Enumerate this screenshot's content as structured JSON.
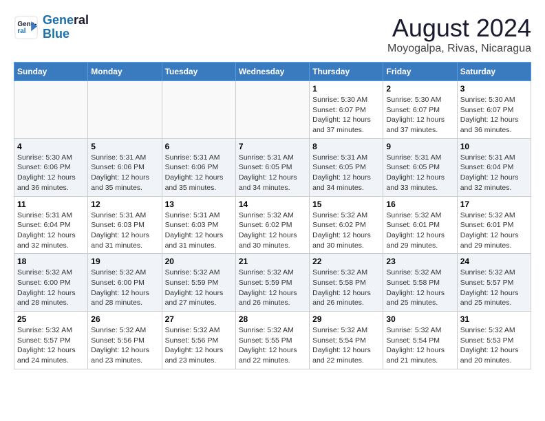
{
  "logo": {
    "line1": "General",
    "line2": "Blue"
  },
  "title": "August 2024",
  "subtitle": "Moyogalpa, Rivas, Nicaragua",
  "days_of_week": [
    "Sunday",
    "Monday",
    "Tuesday",
    "Wednesday",
    "Thursday",
    "Friday",
    "Saturday"
  ],
  "weeks": [
    [
      {
        "num": "",
        "info": ""
      },
      {
        "num": "",
        "info": ""
      },
      {
        "num": "",
        "info": ""
      },
      {
        "num": "",
        "info": ""
      },
      {
        "num": "1",
        "info": "Sunrise: 5:30 AM\nSunset: 6:07 PM\nDaylight: 12 hours\nand 37 minutes."
      },
      {
        "num": "2",
        "info": "Sunrise: 5:30 AM\nSunset: 6:07 PM\nDaylight: 12 hours\nand 37 minutes."
      },
      {
        "num": "3",
        "info": "Sunrise: 5:30 AM\nSunset: 6:07 PM\nDaylight: 12 hours\nand 36 minutes."
      }
    ],
    [
      {
        "num": "4",
        "info": "Sunrise: 5:30 AM\nSunset: 6:06 PM\nDaylight: 12 hours\nand 36 minutes."
      },
      {
        "num": "5",
        "info": "Sunrise: 5:31 AM\nSunset: 6:06 PM\nDaylight: 12 hours\nand 35 minutes."
      },
      {
        "num": "6",
        "info": "Sunrise: 5:31 AM\nSunset: 6:06 PM\nDaylight: 12 hours\nand 35 minutes."
      },
      {
        "num": "7",
        "info": "Sunrise: 5:31 AM\nSunset: 6:05 PM\nDaylight: 12 hours\nand 34 minutes."
      },
      {
        "num": "8",
        "info": "Sunrise: 5:31 AM\nSunset: 6:05 PM\nDaylight: 12 hours\nand 34 minutes."
      },
      {
        "num": "9",
        "info": "Sunrise: 5:31 AM\nSunset: 6:05 PM\nDaylight: 12 hours\nand 33 minutes."
      },
      {
        "num": "10",
        "info": "Sunrise: 5:31 AM\nSunset: 6:04 PM\nDaylight: 12 hours\nand 32 minutes."
      }
    ],
    [
      {
        "num": "11",
        "info": "Sunrise: 5:31 AM\nSunset: 6:04 PM\nDaylight: 12 hours\nand 32 minutes."
      },
      {
        "num": "12",
        "info": "Sunrise: 5:31 AM\nSunset: 6:03 PM\nDaylight: 12 hours\nand 31 minutes."
      },
      {
        "num": "13",
        "info": "Sunrise: 5:31 AM\nSunset: 6:03 PM\nDaylight: 12 hours\nand 31 minutes."
      },
      {
        "num": "14",
        "info": "Sunrise: 5:32 AM\nSunset: 6:02 PM\nDaylight: 12 hours\nand 30 minutes."
      },
      {
        "num": "15",
        "info": "Sunrise: 5:32 AM\nSunset: 6:02 PM\nDaylight: 12 hours\nand 30 minutes."
      },
      {
        "num": "16",
        "info": "Sunrise: 5:32 AM\nSunset: 6:01 PM\nDaylight: 12 hours\nand 29 minutes."
      },
      {
        "num": "17",
        "info": "Sunrise: 5:32 AM\nSunset: 6:01 PM\nDaylight: 12 hours\nand 29 minutes."
      }
    ],
    [
      {
        "num": "18",
        "info": "Sunrise: 5:32 AM\nSunset: 6:00 PM\nDaylight: 12 hours\nand 28 minutes."
      },
      {
        "num": "19",
        "info": "Sunrise: 5:32 AM\nSunset: 6:00 PM\nDaylight: 12 hours\nand 28 minutes."
      },
      {
        "num": "20",
        "info": "Sunrise: 5:32 AM\nSunset: 5:59 PM\nDaylight: 12 hours\nand 27 minutes."
      },
      {
        "num": "21",
        "info": "Sunrise: 5:32 AM\nSunset: 5:59 PM\nDaylight: 12 hours\nand 26 minutes."
      },
      {
        "num": "22",
        "info": "Sunrise: 5:32 AM\nSunset: 5:58 PM\nDaylight: 12 hours\nand 26 minutes."
      },
      {
        "num": "23",
        "info": "Sunrise: 5:32 AM\nSunset: 5:58 PM\nDaylight: 12 hours\nand 25 minutes."
      },
      {
        "num": "24",
        "info": "Sunrise: 5:32 AM\nSunset: 5:57 PM\nDaylight: 12 hours\nand 25 minutes."
      }
    ],
    [
      {
        "num": "25",
        "info": "Sunrise: 5:32 AM\nSunset: 5:57 PM\nDaylight: 12 hours\nand 24 minutes."
      },
      {
        "num": "26",
        "info": "Sunrise: 5:32 AM\nSunset: 5:56 PM\nDaylight: 12 hours\nand 23 minutes."
      },
      {
        "num": "27",
        "info": "Sunrise: 5:32 AM\nSunset: 5:56 PM\nDaylight: 12 hours\nand 23 minutes."
      },
      {
        "num": "28",
        "info": "Sunrise: 5:32 AM\nSunset: 5:55 PM\nDaylight: 12 hours\nand 22 minutes."
      },
      {
        "num": "29",
        "info": "Sunrise: 5:32 AM\nSunset: 5:54 PM\nDaylight: 12 hours\nand 22 minutes."
      },
      {
        "num": "30",
        "info": "Sunrise: 5:32 AM\nSunset: 5:54 PM\nDaylight: 12 hours\nand 21 minutes."
      },
      {
        "num": "31",
        "info": "Sunrise: 5:32 AM\nSunset: 5:53 PM\nDaylight: 12 hours\nand 20 minutes."
      }
    ]
  ]
}
